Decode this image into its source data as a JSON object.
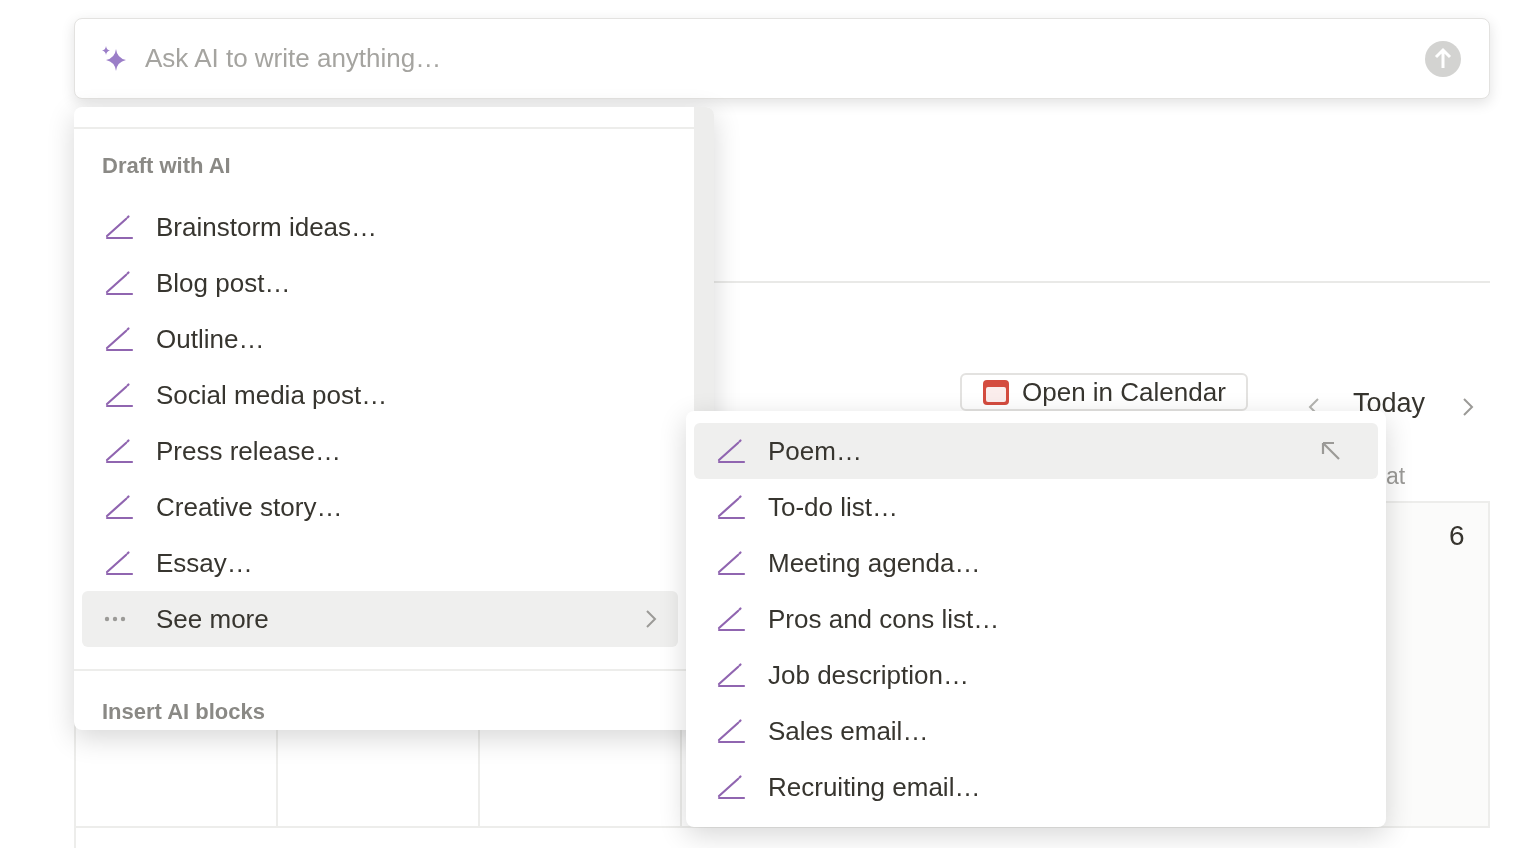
{
  "ai_prompt": {
    "placeholder": "Ask AI to write anything…"
  },
  "background": {
    "calendar_button": "Open in Calendar",
    "today_button": "Today",
    "weekday": "at",
    "date": "6"
  },
  "menu": {
    "section_title": "Draft with AI",
    "items": [
      {
        "label": "Brainstorm ideas…",
        "kind": "pencil",
        "selected": false
      },
      {
        "label": "Blog post…",
        "kind": "pencil",
        "selected": false
      },
      {
        "label": "Outline…",
        "kind": "pencil",
        "selected": false
      },
      {
        "label": "Social media post…",
        "kind": "pencil",
        "selected": false
      },
      {
        "label": "Press release…",
        "kind": "pencil",
        "selected": false
      },
      {
        "label": "Creative story…",
        "kind": "pencil",
        "selected": false
      },
      {
        "label": "Essay…",
        "kind": "pencil",
        "selected": false
      },
      {
        "label": "See more",
        "kind": "more",
        "selected": true
      }
    ],
    "footer_title": "Insert AI blocks"
  },
  "submenu": {
    "items": [
      {
        "label": "Poem…",
        "selected": true
      },
      {
        "label": "To-do list…",
        "selected": false
      },
      {
        "label": "Meeting agenda…",
        "selected": false
      },
      {
        "label": "Pros and cons list…",
        "selected": false
      },
      {
        "label": "Job description…",
        "selected": false
      },
      {
        "label": "Sales email…",
        "selected": false
      },
      {
        "label": "Recruiting email…",
        "selected": false
      }
    ]
  }
}
